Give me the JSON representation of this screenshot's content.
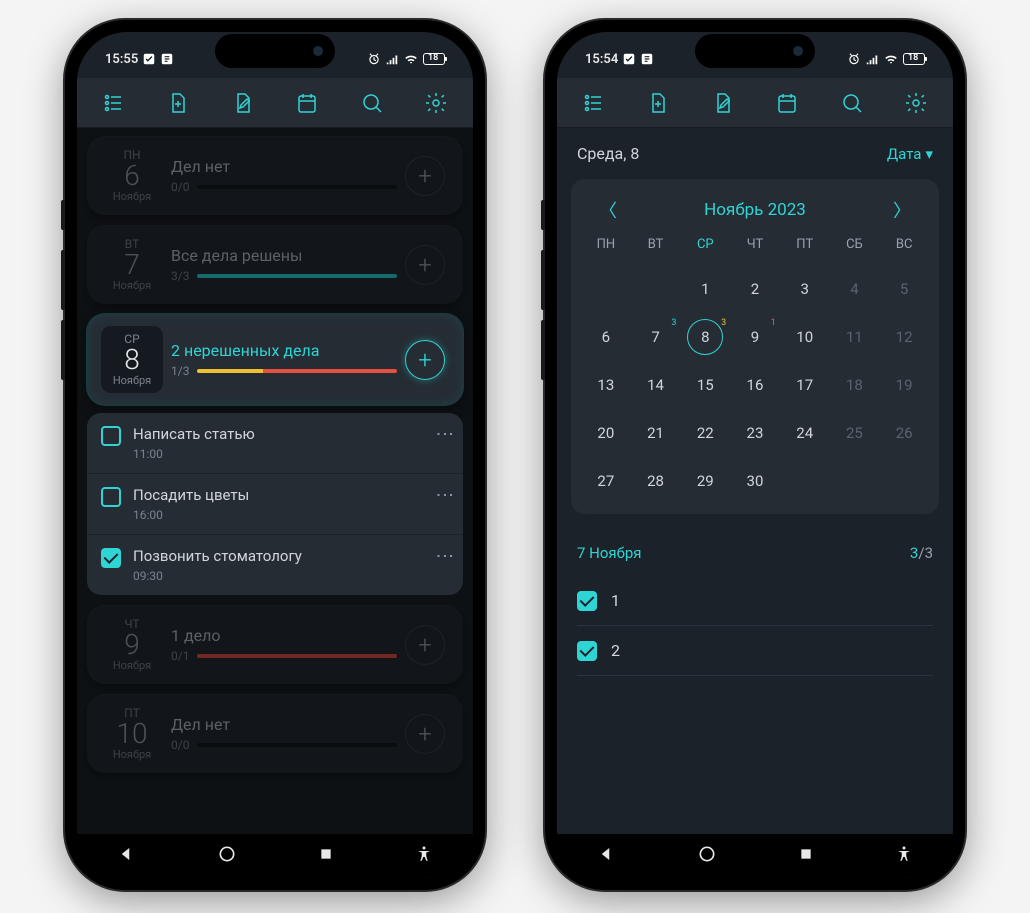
{
  "colors": {
    "accent": "#2fd4d4",
    "yellow": "#f0c030",
    "red": "#e55040"
  },
  "left": {
    "status": {
      "time": "15:55",
      "battery": "18"
    },
    "days": [
      {
        "dow": "ПН",
        "num": "6",
        "month": "Ноября",
        "title": "Дел нет",
        "count": "0/0",
        "segs": []
      },
      {
        "dow": "ВТ",
        "num": "7",
        "month": "Ноября",
        "title": "Все дела решены",
        "count": "3/3",
        "segs": [
          [
            "#2fd4d4",
            100
          ]
        ]
      },
      {
        "dow": "СР",
        "num": "8",
        "month": "Ноября",
        "title": "2 нерешенных дела",
        "count": "1/3",
        "segs": [
          [
            "#f0c030",
            33
          ],
          [
            "#e55040",
            67
          ]
        ],
        "active": true
      },
      {
        "dow": "ЧТ",
        "num": "9",
        "month": "Ноября",
        "title": "1 дело",
        "count": "0/1",
        "segs": [
          [
            "#e55040",
            100
          ]
        ]
      },
      {
        "dow": "ПТ",
        "num": "10",
        "month": "Ноября",
        "title": "Дел нет",
        "count": "0/0",
        "segs": []
      }
    ],
    "tasks": [
      {
        "title": "Написать статью",
        "time": "11:00",
        "done": false
      },
      {
        "title": "Посадить цветы",
        "time": "16:00",
        "done": false
      },
      {
        "title": "Позвонить стоматологу",
        "time": "09:30",
        "done": true
      }
    ]
  },
  "right": {
    "status": {
      "time": "15:54",
      "battery": "18"
    },
    "header": {
      "current": "Среда, 8",
      "mode": "Дата"
    },
    "calendar": {
      "title": "Ноябрь 2023",
      "dow": [
        "ПН",
        "ВТ",
        "СР",
        "ЧТ",
        "ПТ",
        "СБ",
        "ВС"
      ],
      "today_col": 2,
      "weeks": [
        [
          null,
          null,
          {
            "n": 1
          },
          {
            "n": 2
          },
          {
            "n": 3
          },
          {
            "n": 4,
            "dim": true
          },
          {
            "n": 5,
            "dim": true
          }
        ],
        [
          {
            "n": 6
          },
          {
            "n": 7,
            "badge": "3",
            "bc": "teal"
          },
          {
            "n": 8,
            "today": true,
            "badge": "3",
            "bc": "yel"
          },
          {
            "n": 9,
            "badge": "1",
            "bc": "red"
          },
          {
            "n": 10
          },
          {
            "n": 11,
            "dim": true
          },
          {
            "n": 12,
            "dim": true
          }
        ],
        [
          {
            "n": 13
          },
          {
            "n": 14
          },
          {
            "n": 15
          },
          {
            "n": 16
          },
          {
            "n": 17
          },
          {
            "n": 18,
            "dim": true
          },
          {
            "n": 19,
            "dim": true
          }
        ],
        [
          {
            "n": 20
          },
          {
            "n": 21
          },
          {
            "n": 22
          },
          {
            "n": 23
          },
          {
            "n": 24
          },
          {
            "n": 25,
            "dim": true
          },
          {
            "n": 26,
            "dim": true
          }
        ],
        [
          {
            "n": 27
          },
          {
            "n": 28
          },
          {
            "n": 29
          },
          {
            "n": 30
          },
          null,
          null,
          null
        ]
      ]
    },
    "below": {
      "title": "7 Ноября",
      "done": "3",
      "total": "3",
      "items": [
        {
          "n": "1",
          "done": true
        },
        {
          "n": "2",
          "done": true
        }
      ]
    }
  }
}
